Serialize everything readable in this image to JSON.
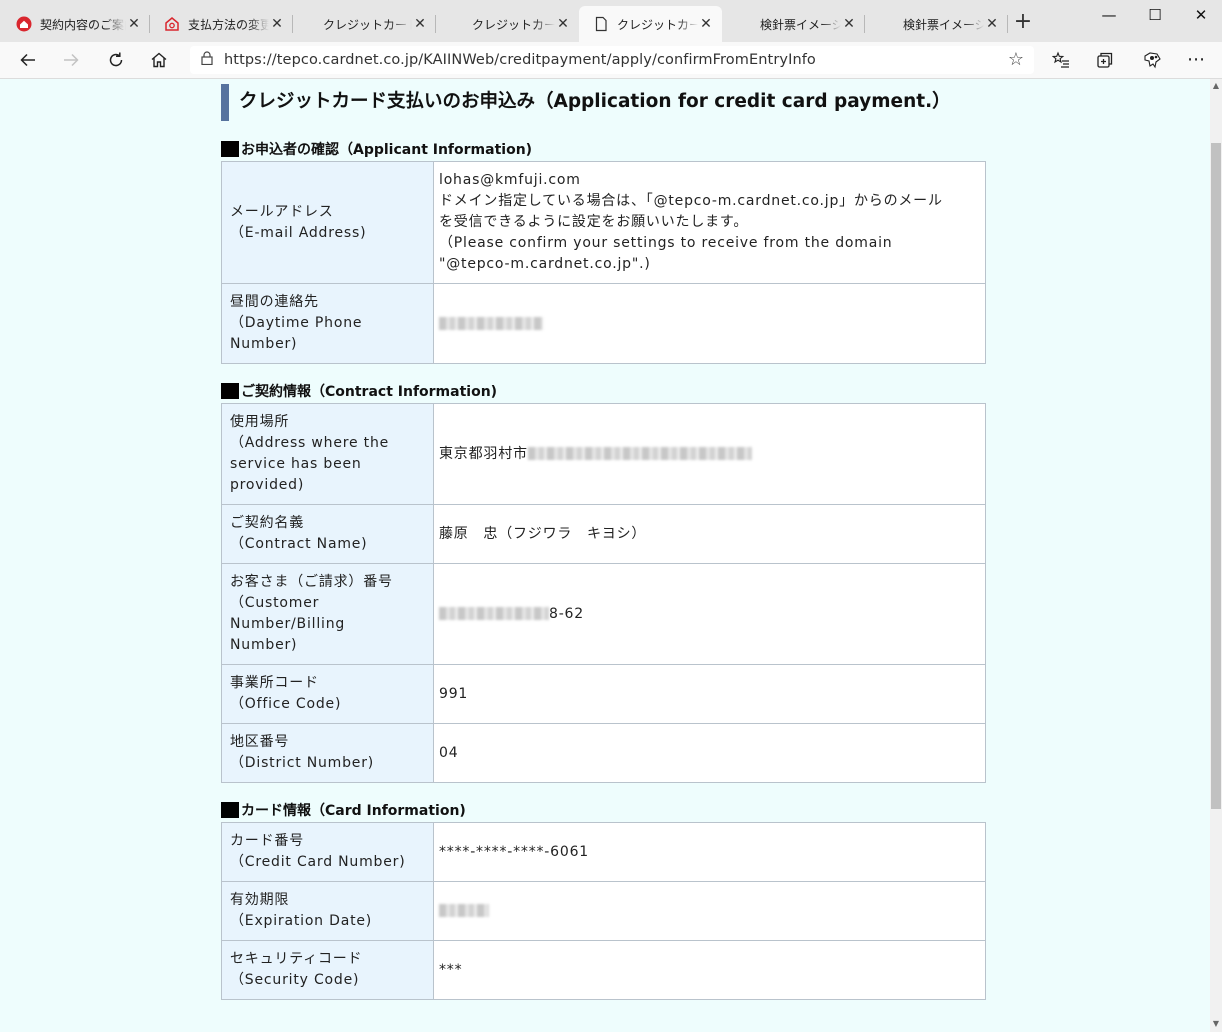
{
  "browser": {
    "tabs": [
      {
        "title": "契約内容のご案内",
        "icon": "tepco-home-icon"
      },
      {
        "title": "支払方法の変更",
        "icon": "tepco-house-icon"
      },
      {
        "title": "クレジットカード支払い",
        "icon": "none"
      },
      {
        "title": "クレジットカード支払い",
        "icon": "none"
      },
      {
        "title": "クレジットカード支払い",
        "icon": "page-icon"
      },
      {
        "title": "検針票イメージ",
        "icon": "none"
      },
      {
        "title": "検針票イメージ",
        "icon": "none"
      }
    ],
    "active_tab_index": 4,
    "url": "https://tepco.cardnet.co.jp/KAIINWeb/creditpayment/apply/confirmFromEntryInfo",
    "new_tab_label": "+",
    "close_glyph": "✕"
  },
  "page": {
    "heading": "クレジットカード支払いのお申込み（Application for credit card payment.）",
    "sections": {
      "applicant": {
        "title": "お申込者の確認（Applicant Information)",
        "email_label_ja": "メールアドレス",
        "email_label_en": "（E-mail Address)",
        "email_value": "lohas@kmfuji.com",
        "email_note_ja_1": "ドメイン指定している場合は、「@tepco-m.cardnet.co.jp」からのメール",
        "email_note_ja_2": "を受信できるように設定をお願いいたします。",
        "email_note_en_1": "（Please confirm your settings to receive from the domain",
        "email_note_en_2": "\"@tepco-m.cardnet.co.jp\".)",
        "phone_label_ja": "昼間の連絡先",
        "phone_label_en_1": "（Daytime Phone",
        "phone_label_en_2": "Number)"
      },
      "contract": {
        "title": "ご契約情報（Contract Information)",
        "address_label_ja": "使用場所",
        "address_label_en_1": "（Address where the",
        "address_label_en_2": "service has been",
        "address_label_en_3": "provided)",
        "address_value": "東京都羽村市",
        "name_label_ja": "ご契約名義",
        "name_label_en": "（Contract Name)",
        "name_value": "藤原　忠（フジワラ　キヨシ）",
        "customer_label_ja": "お客さま（ご請求）番号",
        "customer_label_en_1": "（Customer",
        "customer_label_en_2": "Number/Billing",
        "customer_label_en_3": "Number)",
        "customer_value_suffix": "8-62",
        "office_label_ja": "事業所コード",
        "office_label_en": "（Office Code)",
        "office_value": "991",
        "district_label_ja": "地区番号",
        "district_label_en": "（District Number)",
        "district_value": "04"
      },
      "card": {
        "title": "カード情報（Card Information)",
        "number_label_ja": "カード番号",
        "number_label_en": "（Credit Card Number)",
        "number_value": "****-****-****-6061",
        "expiry_label_ja": "有効期限",
        "expiry_label_en": "（Expiration Date)",
        "security_label_ja": "セキュリティコード",
        "security_label_en": "（Security Code)",
        "security_value": "***"
      }
    }
  }
}
